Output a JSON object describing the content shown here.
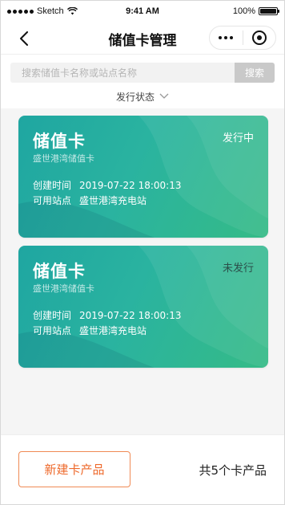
{
  "status_bar": {
    "carrier": "Sketch",
    "time": "9:41 AM",
    "battery": "100%"
  },
  "nav": {
    "title": "储值卡管理",
    "back_icon": "chevron-left-icon",
    "more_icon": "more-dots-icon",
    "close_icon": "target-icon"
  },
  "search": {
    "placeholder": "搜索储值卡名称或站点名称",
    "value": "",
    "button_label": "搜索"
  },
  "filter": {
    "label": "发行状态",
    "icon": "chevron-down-icon"
  },
  "cards": [
    {
      "title": "储值卡",
      "subtitle": "盛世港湾储值卡",
      "status": "发行中",
      "created_label": "创建时间",
      "created_value": "2019-07-22 18:00:13",
      "station_label": "可用站点",
      "station_value": "盛世港湾充电站"
    },
    {
      "title": "储值卡",
      "subtitle": "盛世港湾储值卡",
      "status": "未发行",
      "created_label": "创建时间",
      "created_value": "2019-07-22 18:00:13",
      "station_label": "可用站点",
      "station_value": "盛世港湾充电站"
    }
  ],
  "footer": {
    "new_button_label": "新建卡产品",
    "total_text": "共5个卡产品"
  },
  "colors": {
    "accent": "#ee6a2c",
    "card_gradient_start": "#1fa6a1",
    "card_gradient_end": "#35bb86",
    "search_button": "#c9c9c9"
  }
}
